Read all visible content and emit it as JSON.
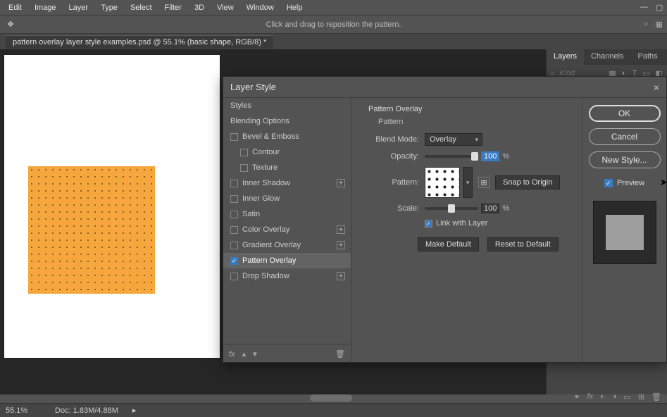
{
  "menu": [
    "Edit",
    "Image",
    "Layer",
    "Type",
    "Select",
    "Filter",
    "3D",
    "View",
    "Window",
    "Help"
  ],
  "hint": "Click and drag to reposition the pattern.",
  "document_tab": "pattern overlay layer style examples.psd @ 55.1% (basic shape, RGB/8) *",
  "panels": {
    "tabs": [
      "Layers",
      "Channels",
      "Paths"
    ],
    "active_tab": 0,
    "filter_placeholder": "Kind"
  },
  "dialog": {
    "title": "Layer Style",
    "styles_header": "Styles",
    "blending_options": "Blending Options",
    "effects": [
      {
        "label": "Bevel & Emboss",
        "checked": false,
        "indent": 0,
        "plus": false
      },
      {
        "label": "Contour",
        "checked": false,
        "indent": 1,
        "plus": false
      },
      {
        "label": "Texture",
        "checked": false,
        "indent": 1,
        "plus": false
      },
      {
        "label": "Inner Shadow",
        "checked": false,
        "indent": 0,
        "plus": true
      },
      {
        "label": "Inner Glow",
        "checked": false,
        "indent": 0,
        "plus": false
      },
      {
        "label": "Satin",
        "checked": false,
        "indent": 0,
        "plus": false
      },
      {
        "label": "Color Overlay",
        "checked": false,
        "indent": 0,
        "plus": true
      },
      {
        "label": "Gradient Overlay",
        "checked": false,
        "indent": 0,
        "plus": true
      },
      {
        "label": "Pattern Overlay",
        "checked": true,
        "indent": 0,
        "plus": false,
        "active": true
      },
      {
        "label": "Drop Shadow",
        "checked": false,
        "indent": 0,
        "plus": true
      }
    ],
    "section_title": "Pattern Overlay",
    "section_sub": "Pattern",
    "blend_mode_label": "Blend Mode:",
    "blend_mode_value": "Overlay",
    "opacity_label": "Opacity:",
    "opacity_value": "100",
    "pattern_label": "Pattern:",
    "snap_btn": "Snap to Origin",
    "scale_label": "Scale:",
    "scale_value": "100",
    "percent": "%",
    "link_label": "Link with Layer",
    "make_default": "Make Default",
    "reset_default": "Reset to Default",
    "ok": "OK",
    "cancel": "Cancel",
    "new_style": "New Style...",
    "preview": "Preview"
  },
  "status": {
    "zoom": "55.1%",
    "doc_info": "Doc: 1.83M/4.88M"
  }
}
